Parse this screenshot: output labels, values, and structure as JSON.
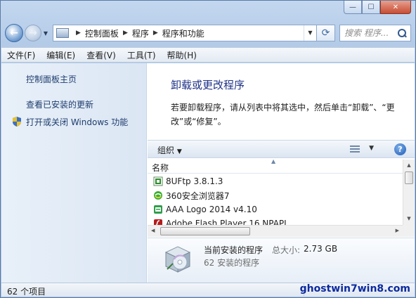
{
  "window": {
    "caption": {
      "minimize": "—",
      "maximize": "☐",
      "close": "✕"
    }
  },
  "address": {
    "crumbs": [
      "控制面板",
      "程序",
      "程序和功能"
    ],
    "search_placeholder": "搜索 程序..."
  },
  "menu": [
    "文件(F)",
    "编辑(E)",
    "查看(V)",
    "工具(T)",
    "帮助(H)"
  ],
  "sidebar": {
    "items": [
      "控制面板主页",
      "查看已安装的更新",
      "打开或关闭 Windows 功能"
    ]
  },
  "main": {
    "title": "卸载或更改程序",
    "description": "若要卸载程序，请从列表中将其选中，然后单击“卸载”、“更改”或“修复”。",
    "organize": "组织",
    "column_name": "名称",
    "programs": [
      {
        "name": "8UFtp 3.8.1.3",
        "icon": "ftp-icon",
        "color": "#2e8b2e"
      },
      {
        "name": "360安全浏览器7",
        "icon": "browser-360-icon",
        "color": "#3cae2f"
      },
      {
        "name": "AAA Logo 2014 v4.10",
        "icon": "logo-app-icon",
        "color": "#2f9e4a"
      },
      {
        "name": "Adobe Flash Player 16 NPAPI",
        "icon": "flash-icon",
        "color": "#b51d1d"
      }
    ]
  },
  "details": {
    "title": "当前安装的程序",
    "size_label": "总大小:",
    "size_value": "2.73 GB",
    "count": "62 安装的程序"
  },
  "status": {
    "items_count": "62 个项目",
    "watermark": "ghostwin7win8.com"
  }
}
